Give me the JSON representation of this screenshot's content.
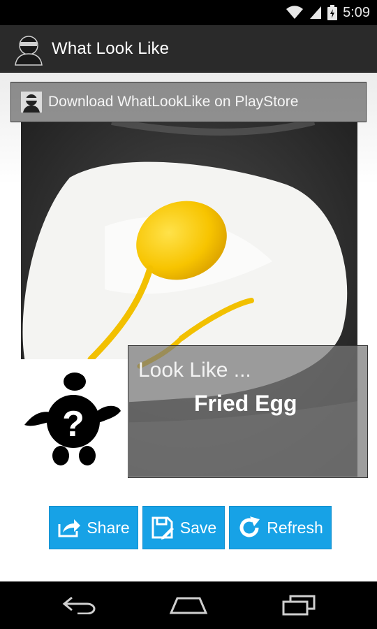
{
  "status_bar": {
    "time": "5:09",
    "icons": [
      "wifi-icon",
      "signal-icon",
      "battery-icon"
    ]
  },
  "action_bar": {
    "title": "What Look Like",
    "logo_icon": "thief-logo-icon"
  },
  "banner": {
    "label": "Download WhatLookLike on PlayStore"
  },
  "result": {
    "heading": "Look Like ...",
    "value": "Fried Egg"
  },
  "buttons": {
    "share": "Share",
    "save": "Save",
    "refresh": "Refresh"
  },
  "colors": {
    "action_bar": "#2a2a2a",
    "button": "#17a2e6",
    "status_bar": "#000000"
  },
  "nav": [
    "back-icon",
    "home-icon",
    "recents-icon"
  ]
}
